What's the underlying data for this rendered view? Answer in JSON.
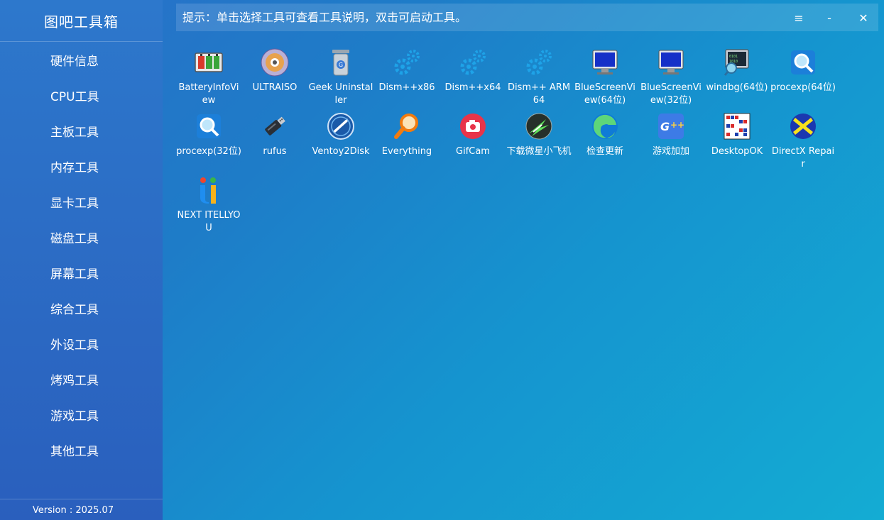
{
  "app": {
    "title": "图吧工具箱",
    "version": "Version : 2025.07"
  },
  "sidebar": {
    "items": [
      {
        "label": "硬件信息"
      },
      {
        "label": "CPU工具"
      },
      {
        "label": "主板工具"
      },
      {
        "label": "内存工具"
      },
      {
        "label": "显卡工具"
      },
      {
        "label": "磁盘工具"
      },
      {
        "label": "屏幕工具"
      },
      {
        "label": "综合工具"
      },
      {
        "label": "外设工具"
      },
      {
        "label": "烤鸡工具"
      },
      {
        "label": "游戏工具"
      },
      {
        "label": "其他工具"
      }
    ]
  },
  "hint": {
    "text": "提示：单击选择工具可查看工具说明，双击可启动工具。",
    "menu_symbol": "≡",
    "minimize_symbol": "-",
    "close_symbol": "✕"
  },
  "tools": [
    {
      "label": "BatteryInfoView",
      "icon": "battery-icon"
    },
    {
      "label": "ULTRAISO",
      "icon": "disc-icon"
    },
    {
      "label": "Geek Uninstaller",
      "icon": "trash-bin-icon"
    },
    {
      "label": "Dism++x86",
      "icon": "gears-icon"
    },
    {
      "label": "Dism++x64",
      "icon": "gears-icon"
    },
    {
      "label": "Dism++ ARM64",
      "icon": "gears-icon"
    },
    {
      "label": "BlueScreenView(64位)",
      "icon": "monitor-icon"
    },
    {
      "label": "BlueScreenView(32位)",
      "icon": "monitor-icon"
    },
    {
      "label": "windbg(64位)",
      "icon": "debugger-icon"
    },
    {
      "label": "procexp(64位)",
      "icon": "magnifier-icon"
    },
    {
      "label": "procexp(32位)",
      "icon": "magnifier-icon"
    },
    {
      "label": "rufus",
      "icon": "usb-drive-icon"
    },
    {
      "label": "Ventoy2Disk",
      "icon": "ventoy-icon"
    },
    {
      "label": "Everything",
      "icon": "search-icon"
    },
    {
      "label": "GifCam",
      "icon": "camera-icon"
    },
    {
      "label": "下载微星小飞机",
      "icon": "afterburner-icon"
    },
    {
      "label": "检查更新",
      "icon": "edge-icon"
    },
    {
      "label": "游戏加加",
      "icon": "game-plus-icon"
    },
    {
      "label": "DesktopOK",
      "icon": "desktop-grid-icon"
    },
    {
      "label": "DirectX Repair",
      "icon": "directx-icon"
    },
    {
      "label": "NEXT ITELLYOU",
      "icon": "itellyou-icon"
    }
  ]
}
